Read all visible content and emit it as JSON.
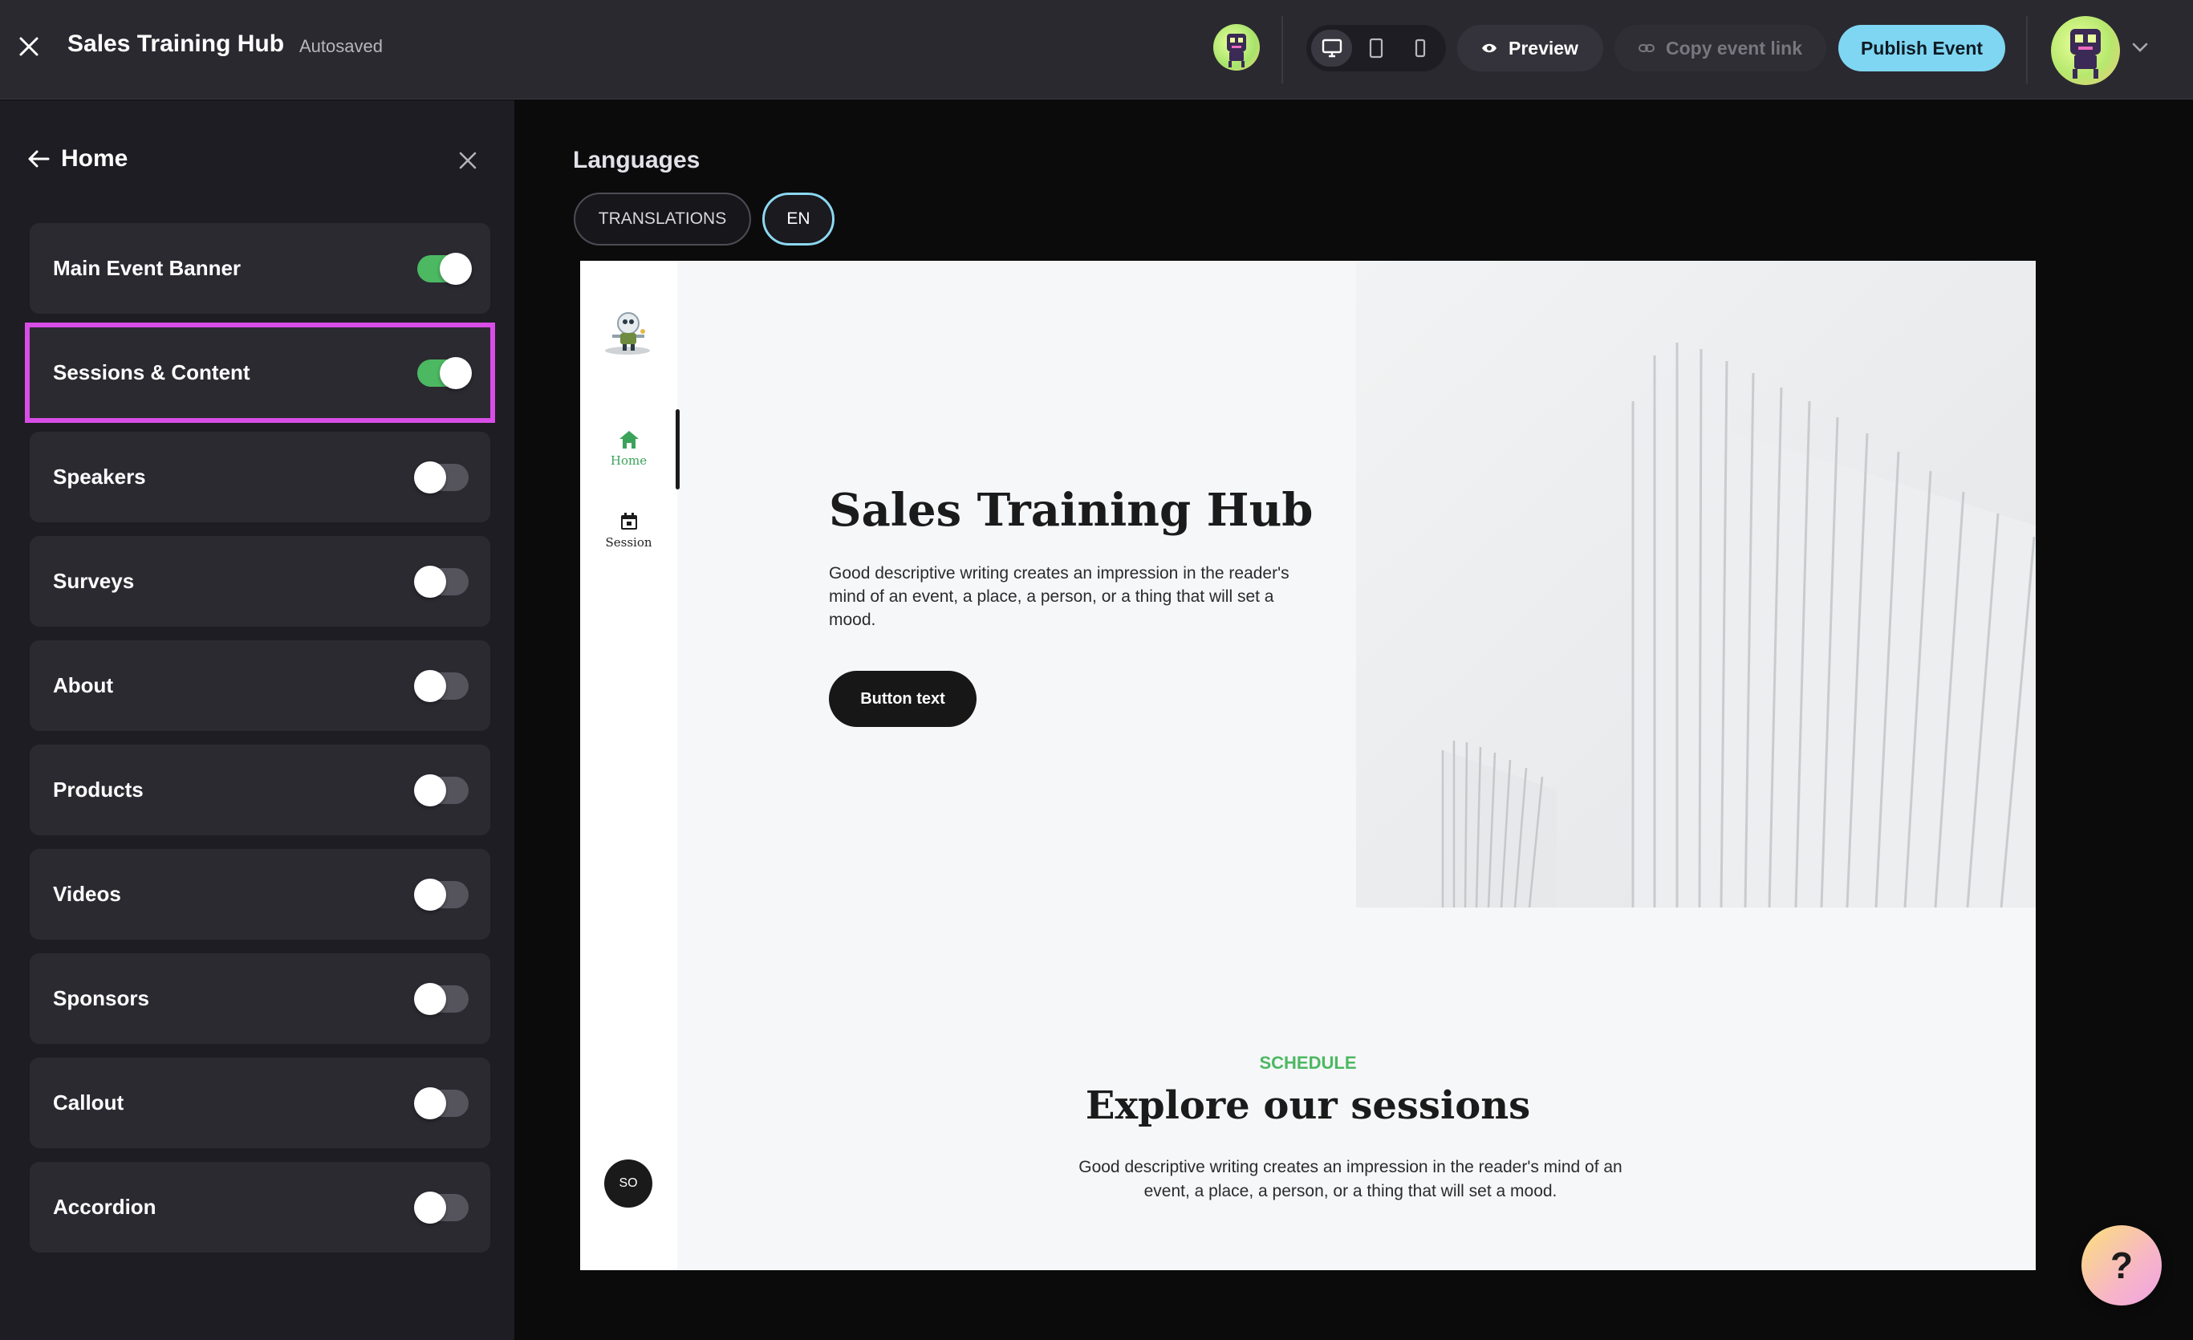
{
  "app": {
    "title": "Sales Training Hub",
    "status": "Autosaved"
  },
  "toolbar": {
    "devices": [
      "desktop-icon",
      "tablet-icon",
      "mobile-icon"
    ],
    "active_device": "desktop",
    "preview_label": "Preview",
    "copy_link_label": "Copy event link",
    "publish_label": "Publish Event",
    "accent_color": "#7fd6f2"
  },
  "sidebar": {
    "back_label": "Home",
    "items": [
      {
        "label": "Main Event Banner",
        "enabled": true
      },
      {
        "label": "Sessions & Content",
        "enabled": true,
        "selected": true
      },
      {
        "label": "Speakers",
        "enabled": false
      },
      {
        "label": "Surveys",
        "enabled": false
      },
      {
        "label": "About",
        "enabled": false
      },
      {
        "label": "Products",
        "enabled": false
      },
      {
        "label": "Videos",
        "enabled": false
      },
      {
        "label": "Sponsors",
        "enabled": false
      },
      {
        "label": "Callout",
        "enabled": false
      },
      {
        "label": "Accordion",
        "enabled": false
      }
    ],
    "toggle_on_color": "#4cb862",
    "selection_color": "#d84de6"
  },
  "languages": {
    "title": "Languages",
    "translations_label": "TRANSLATIONS",
    "current": "EN"
  },
  "preview": {
    "nav": {
      "home_label": "Home",
      "session_label": "Session",
      "user_initials": "SO"
    },
    "hero": {
      "title": "Sales Training Hub",
      "description": "Good descriptive writing creates an impression in the reader's mind of an event, a place, a person, or a thing that will set a mood.",
      "button_label": "Button text"
    },
    "schedule": {
      "eyebrow": "SCHEDULE",
      "title": "Explore our sessions",
      "description": "Good descriptive writing creates an impression in the reader's mind of an event, a place, a person, or a thing that will set a mood."
    }
  },
  "help": {
    "label": "?"
  }
}
